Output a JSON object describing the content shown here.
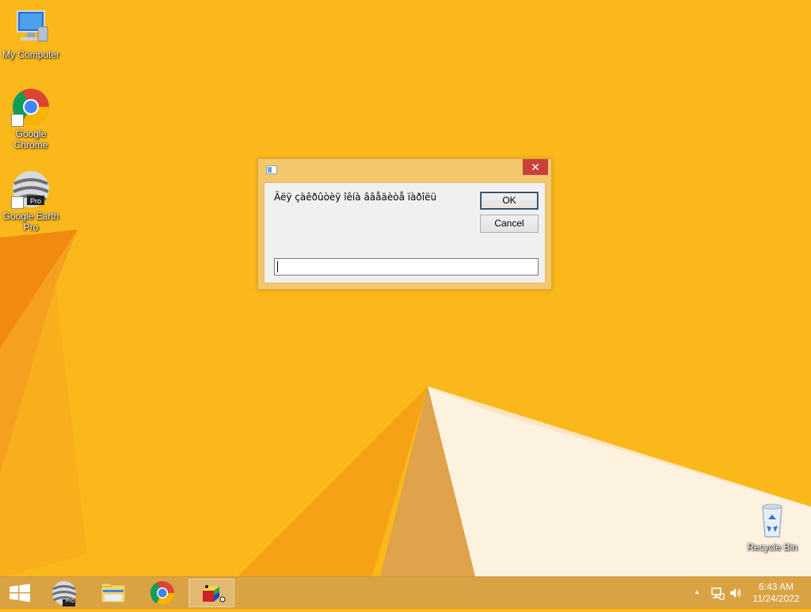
{
  "desktop": {
    "icons": [
      {
        "label": "My Computer"
      },
      {
        "label": "Google Chrome"
      },
      {
        "label": "Google Earth Pro"
      },
      {
        "label": "Recycle Bin"
      }
    ]
  },
  "dialog": {
    "title": "",
    "prompt": "Äëÿ çàêðûòèÿ îêíà ââåäèòå ïàðîëü",
    "ok_label": "OK",
    "cancel_label": "Cancel",
    "input_value": "",
    "close_glyph": "✕"
  },
  "taskbar": {
    "clock_time": "6:43 AM",
    "clock_date": "11/24/2022",
    "pro_badge": "Pro",
    "tray_up_glyph": "▲"
  },
  "colors": {
    "wallpaper": "#fbb81a",
    "close_button": "#c7413a",
    "taskbar": "#d6a046"
  }
}
